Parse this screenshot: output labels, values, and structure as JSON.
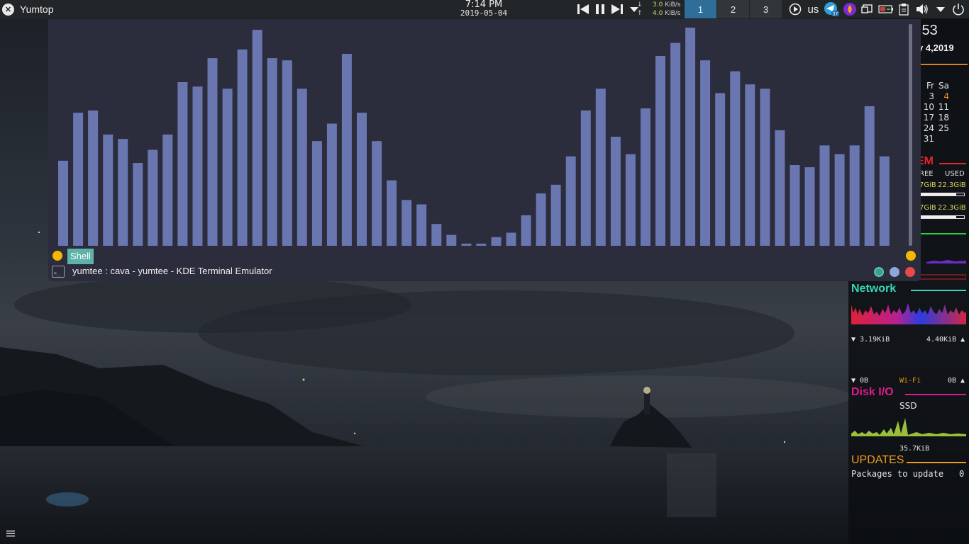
{
  "top_panel": {
    "app_name": "Yumtop",
    "clock": {
      "time": "7:14 PM",
      "date": "2019-05-04"
    },
    "net_speed": {
      "down_value": "3.0",
      "up_value": "4.0",
      "unit": "KiB/s"
    },
    "desktops": [
      {
        "label": "1",
        "active": true
      },
      {
        "label": "2",
        "active": false
      },
      {
        "label": "3",
        "active": false
      }
    ],
    "keyboard_layout": "us",
    "telegram_badge": "37"
  },
  "terminal": {
    "tab_label": "Shell",
    "window_title": "yumtee : cava - yumtee - KDE Terminal Emulator",
    "icon_text": ">_",
    "visualizer_bar_color": "#6a76b0",
    "visualizer_levels": [
      0.39,
      0.61,
      0.62,
      0.51,
      0.49,
      0.38,
      0.44,
      0.51,
      0.75,
      0.73,
      0.86,
      0.72,
      0.9,
      0.99,
      0.86,
      0.85,
      0.72,
      0.48,
      0.56,
      0.88,
      0.61,
      0.48,
      0.3,
      0.21,
      0.19,
      0.1,
      0.05,
      0.01,
      0.01,
      0.04,
      0.06,
      0.14,
      0.24,
      0.28,
      0.41,
      0.62,
      0.72,
      0.5,
      0.42,
      0.63,
      0.87,
      0.93,
      1.0,
      0.85,
      0.7,
      0.8,
      0.74,
      0.72,
      0.53,
      0.37,
      0.36,
      0.46,
      0.42,
      0.46,
      0.64,
      0.41
    ]
  },
  "conky": {
    "time": ":53",
    "date": "y 4,2019",
    "calendar": {
      "headers": [
        "Fr",
        "Sa"
      ],
      "rows": [
        [
          "3",
          "4"
        ],
        [
          "10",
          "11"
        ],
        [
          "17",
          "18"
        ],
        [
          "24",
          "25"
        ],
        [
          "31",
          ""
        ]
      ]
    },
    "mem": {
      "title": "EM",
      "free_header": "REE",
      "used_header": "USED",
      "row1_free": "7GiB",
      "row1_used": "22.3GiB",
      "row2_free": "7GiB",
      "row2_used": "22.3GiB",
      "fill": 0.82
    },
    "network": {
      "title": "Network",
      "down_rate": "▼ 3.19KiB",
      "up_rate": "4.40KiB ▲",
      "down_total": "▼ 0B",
      "interface": "Wi-Fi",
      "up_total": "0B ▲"
    },
    "disk": {
      "title": "Disk I/O",
      "device": "SSD",
      "rate": "35.7KiB"
    },
    "updates": {
      "title": "UPDATES",
      "label": "Packages to update",
      "count": "0"
    }
  },
  "colors": {
    "accent_orange": "#f0a22a",
    "network_teal": "#35d8b8",
    "disk_pink": "#e2198a",
    "mem_red": "#e0252c",
    "updates_orange": "#f09a1e",
    "wifi_orange": "#e8961c"
  }
}
